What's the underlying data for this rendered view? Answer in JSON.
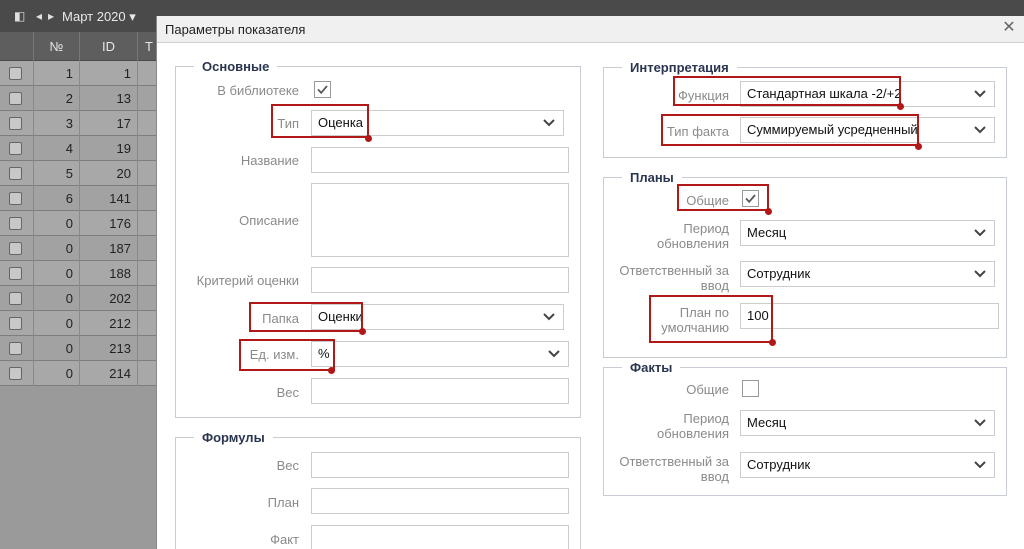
{
  "toolbar": {
    "month_label": "Март 2020"
  },
  "grid": {
    "col_number": "№",
    "col_id": "ID",
    "col_more": "Т",
    "rows": [
      {
        "n": "1",
        "id": "1"
      },
      {
        "n": "2",
        "id": "13"
      },
      {
        "n": "3",
        "id": "17"
      },
      {
        "n": "4",
        "id": "19"
      },
      {
        "n": "5",
        "id": "20"
      },
      {
        "n": "6",
        "id": "141"
      },
      {
        "n": "0",
        "id": "176"
      },
      {
        "n": "0",
        "id": "187"
      },
      {
        "n": "0",
        "id": "188"
      },
      {
        "n": "0",
        "id": "202"
      },
      {
        "n": "0",
        "id": "212"
      },
      {
        "n": "0",
        "id": "213"
      },
      {
        "n": "0",
        "id": "214"
      }
    ]
  },
  "dialog": {
    "title": "Параметры показателя",
    "main": {
      "legend": "Основные",
      "library_label": "В библиотеке",
      "library_checked": true,
      "type_label": "Тип",
      "type_value": "Оценка",
      "name_label": "Название",
      "name_value": "",
      "description_label": "Описание",
      "criterion_label": "Критерий оценки",
      "criterion_value": "",
      "folder_label": "Папка",
      "folder_value": "Оценки",
      "unit_label": "Ед. изм.",
      "unit_value": "%",
      "weight_label": "Вес",
      "weight_value": ""
    },
    "formulas": {
      "legend": "Формулы",
      "weight_label": "Вес",
      "plan_label": "План",
      "fact_label": "Факт"
    },
    "interpretation": {
      "legend": "Интерпретация",
      "function_label": "Функция",
      "function_value": "Стандартная шкала -2/+2",
      "fact_type_label": "Тип факта",
      "fact_type_value": "Суммируемый усредненный"
    },
    "plans": {
      "legend": "Планы",
      "common_label": "Общие",
      "common_checked": true,
      "period_label": "Период обновления",
      "period_value": "Месяц",
      "responsible_label": "Ответственный за ввод",
      "responsible_value": "Сотрудник",
      "default_label": "План по умолчанию",
      "default_value": "100"
    },
    "facts": {
      "legend": "Факты",
      "common_label": "Общие",
      "common_checked": false,
      "period_label": "Период обновления",
      "period_value": "Месяц",
      "responsible_label": "Ответственный за ввод",
      "responsible_value": "Сотрудник"
    }
  },
  "colors": {
    "highlight": "#b11818",
    "legend": "#2a3550",
    "label": "#8a8a8a"
  }
}
